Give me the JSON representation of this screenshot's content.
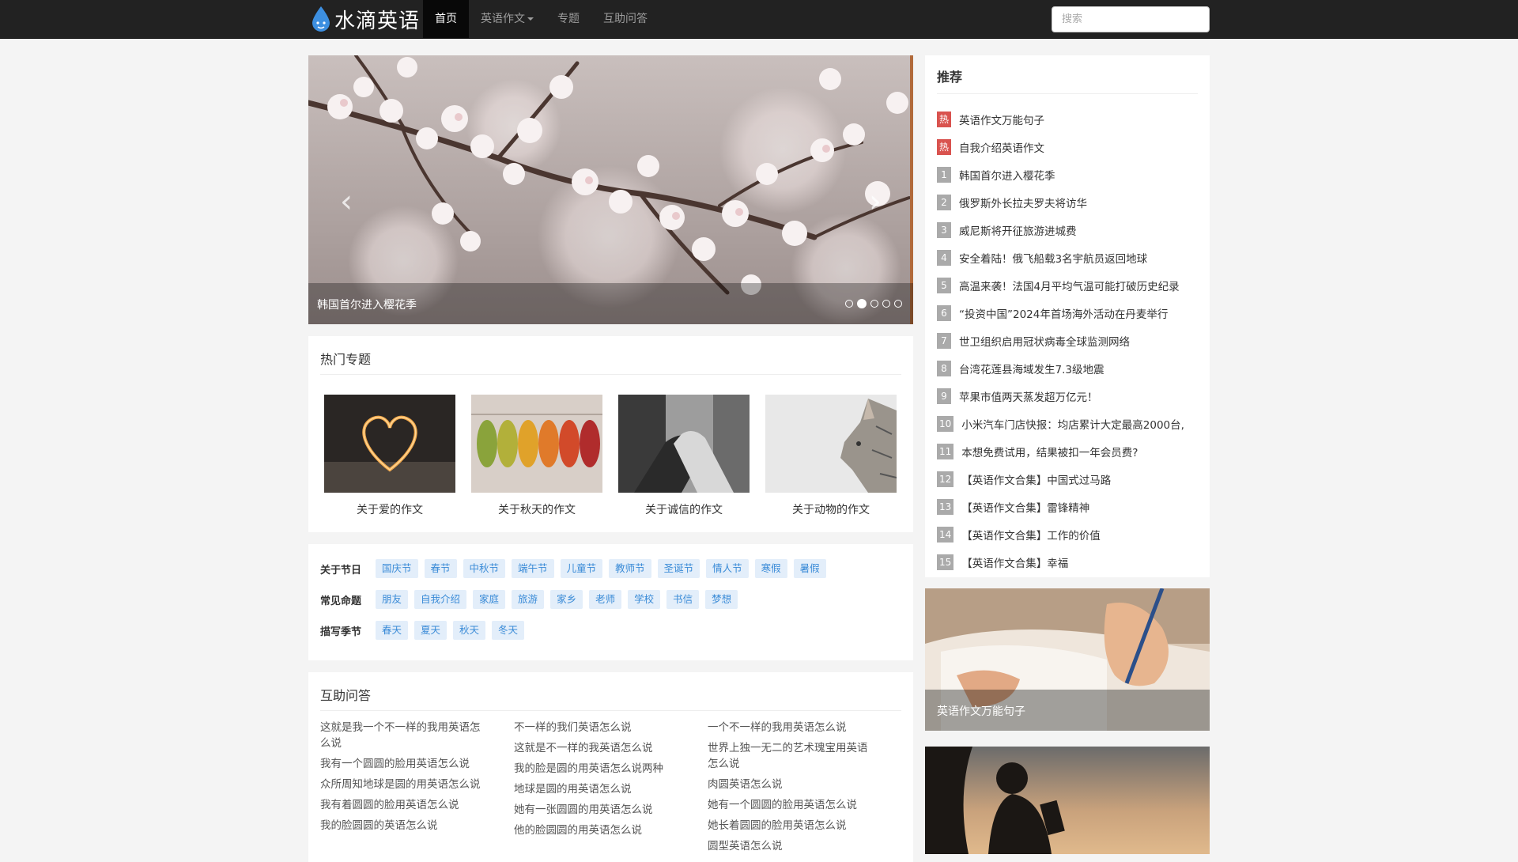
{
  "navbar": {
    "logo_text": "水滴英语",
    "items": [
      {
        "label": "首页",
        "active": true
      },
      {
        "label": "英语作文"
      },
      {
        "label": "专题"
      },
      {
        "label": "互助问答"
      }
    ],
    "search_placeholder": "搜索"
  },
  "carousel": {
    "caption": "韩国首尔进入樱花季",
    "dot_count": 5,
    "active_dot": 2
  },
  "topics": {
    "title": "热门专题",
    "items": [
      {
        "label": "关于爱的作文"
      },
      {
        "label": "关于秋天的作文"
      },
      {
        "label": "关于诚信的作文"
      },
      {
        "label": "关于动物的作文"
      }
    ]
  },
  "tags": {
    "rows": [
      {
        "title": "关于节日",
        "items": [
          "国庆节",
          "春节",
          "中秋节",
          "端午节",
          "儿童节",
          "教师节",
          "圣诞节",
          "情人节",
          "寒假",
          "暑假"
        ]
      },
      {
        "title": "常见命题",
        "items": [
          "朋友",
          "自我介绍",
          "家庭",
          "旅游",
          "家乡",
          "老师",
          "学校",
          "书信",
          "梦想"
        ]
      },
      {
        "title": "描写季节",
        "items": [
          "春天",
          "夏天",
          "秋天",
          "冬天"
        ]
      }
    ]
  },
  "qa": {
    "title": "互助问答",
    "columns": [
      [
        "这就是我一个不一样的我用英语怎么说",
        "我有一个圆圆的脸用英语怎么说",
        "众所周知地球是圆的用英语怎么说",
        "我有着圆圆的脸用英语怎么说",
        "我的脸圆圆的英语怎么说"
      ],
      [
        "不一样的我们英语怎么说",
        "这就是不一样的我英语怎么说",
        "我的脸是圆的用英语怎么说两种",
        "地球是圆的用英语怎么说",
        "她有一张圆圆的用英语怎么说",
        "他的脸圆圆的用英语怎么说"
      ],
      [
        "一个不一样的我用英语怎么说",
        "世界上独一无二的艺术瑰宝用英语怎么说",
        "肉圆英语怎么说",
        "她有一个圆圆的脸用英语怎么说",
        "她长着圆圆的脸用英语怎么说",
        "圆型英语怎么说"
      ]
    ]
  },
  "sidebar": {
    "title": "推荐",
    "items": [
      {
        "badge": "热",
        "hot": true,
        "text": "英语作文万能句子"
      },
      {
        "badge": "热",
        "hot": true,
        "text": "自我介绍英语作文"
      },
      {
        "badge": "1",
        "text": "韩国首尔进入樱花季"
      },
      {
        "badge": "2",
        "text": "俄罗斯外长拉夫罗夫将访华"
      },
      {
        "badge": "3",
        "text": "威尼斯将开征旅游进城费"
      },
      {
        "badge": "4",
        "text": "安全着陆！俄飞船载3名宇航员返回地球"
      },
      {
        "badge": "5",
        "text": "高温来袭！法国4月平均气温可能打破历史纪录"
      },
      {
        "badge": "6",
        "text": "“投资中国”2024年首场海外活动在丹麦举行"
      },
      {
        "badge": "7",
        "text": "世卫组织启用冠状病毒全球监测网络"
      },
      {
        "badge": "8",
        "text": "台湾花莲县海域发生7.3级地震"
      },
      {
        "badge": "9",
        "text": "苹果市值两天蒸发超万亿元！"
      },
      {
        "badge": "10",
        "text": "小米汽车门店快报：均店累计大定最高2000台,"
      },
      {
        "badge": "11",
        "text": "本想免费试用，结果被扣一年会员费?"
      },
      {
        "badge": "12",
        "text": "【英语作文合集】中国式过马路"
      },
      {
        "badge": "13",
        "text": "【英语作文合集】雷锋精神"
      },
      {
        "badge": "14",
        "text": "【英语作文合集】工作的价值"
      },
      {
        "badge": "15",
        "text": "【英语作文合集】幸福"
      }
    ],
    "features": [
      {
        "caption": "英语作文万能句子"
      }
    ]
  },
  "colors": {
    "navbar_bg": "#222222",
    "hot_badge": "#d9534f",
    "num_badge": "#aaaaaa",
    "tag_text": "#3a8bd7",
    "tag_bg": "#e3eefa"
  }
}
